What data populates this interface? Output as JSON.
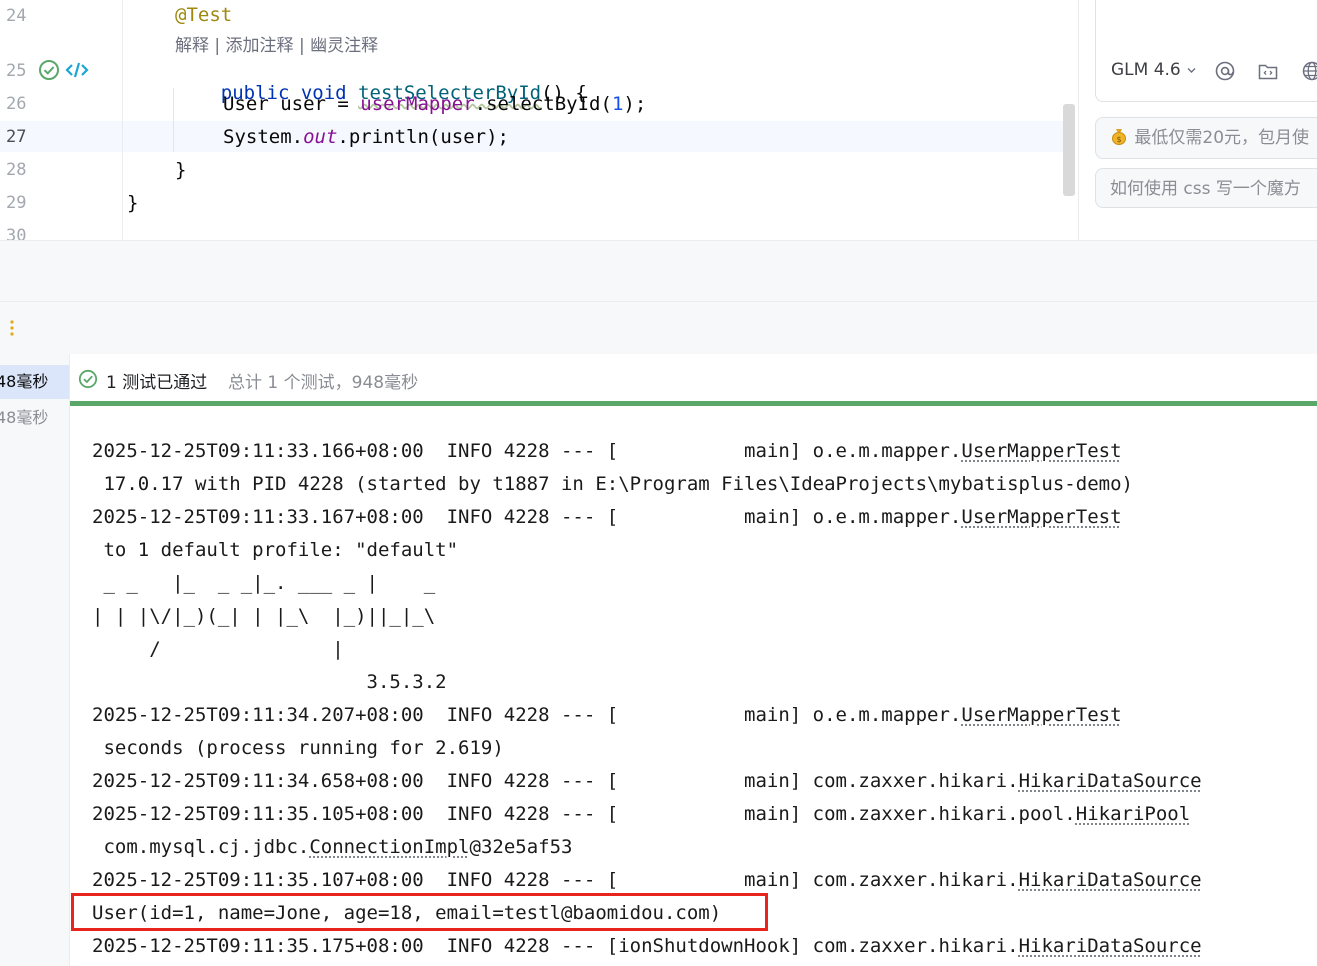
{
  "editor": {
    "line_numbers": [
      "24",
      "25",
      "26",
      "27",
      "28",
      "29",
      "30"
    ],
    "annotation": "@Test",
    "inline_hint": "解释 | 添加注释 | 幽灵注释",
    "method_kw1": "public",
    "method_kw2": "void",
    "method_name": "testSelecterById",
    "method_tail": "() {",
    "line26_type": "User user = ",
    "line26_field": "userMapper",
    "line26_call": ".selectById(",
    "line26_arg": "1",
    "line26_end": ");",
    "line27_a": "System.",
    "line27_static": "out",
    "line27_b": ".println(user);",
    "line28": "}",
    "line29": "}"
  },
  "ai_panel": {
    "model_label": "GLM 4.6",
    "suggestion_1": "最低仅需20元，包月使",
    "suggestion_2": "如何使用 css 写一个魔方",
    "icons": [
      "coin-icon",
      "at-icon",
      "folder-code-icon",
      "globe-icon",
      "chevron-down-icon"
    ]
  },
  "test_tree": {
    "items": [
      "48毫秒",
      "48毫秒"
    ]
  },
  "test_status": {
    "main": "1 测试已通过",
    "sub": "总计 1 个测试，948毫秒"
  },
  "console": {
    "lines": [
      {
        "prefix": "2025-12-25T09:11:33.166+08:00  INFO 4228 --- [           main] o.e.m.mapper.",
        "link": "UserMapperTest"
      },
      {
        "prefix": " 17.0.17 with PID 4228 (started by t1887 in E:\\Program Files\\IdeaProjects\\mybatisplus-demo)",
        "link": ""
      },
      {
        "prefix": "2025-12-25T09:11:33.167+08:00  INFO 4228 --- [           main] o.e.m.mapper.",
        "link": "UserMapperTest"
      },
      {
        "prefix": " to 1 default profile: \"default\"",
        "link": ""
      },
      {
        "prefix": " _ _   |_  _ _|_. ___ _ |    _",
        "link": ""
      },
      {
        "prefix": "| | |\\/|_)(_| | |_\\  |_)||_|_\\",
        "link": ""
      },
      {
        "prefix": "     /               |",
        "link": ""
      },
      {
        "prefix": "                        3.5.3.2",
        "link": ""
      },
      {
        "prefix": "2025-12-25T09:11:34.207+08:00  INFO 4228 --- [           main] o.e.m.mapper.",
        "link": "UserMapperTest"
      },
      {
        "prefix": " seconds (process running for 2.619)",
        "link": ""
      },
      {
        "prefix": "2025-12-25T09:11:34.658+08:00  INFO 4228 --- [           main] com.zaxxer.hikari.",
        "link": "HikariDataSource"
      },
      {
        "prefix": "2025-12-25T09:11:35.105+08:00  INFO 4228 --- [           main] com.zaxxer.hikari.pool.",
        "link": "HikariPool"
      },
      {
        "prefix": " com.mysql.cj.jdbc.",
        "link": "ConnectionImpl",
        "suffix": "@32e5af53"
      },
      {
        "prefix": "2025-12-25T09:11:35.107+08:00  INFO 4228 --- [           main] com.zaxxer.hikari.",
        "link": "HikariDataSource"
      },
      {
        "prefix": "User(id=1, name=Jone, age=18, email=testl@baomidou.com)",
        "link": ""
      },
      {
        "prefix": "2025-12-25T09:11:35.175+08:00  INFO 4228 --- [ionShutdownHook] com.zaxxer.hikari.",
        "link": "HikariDataSource"
      }
    ]
  },
  "colors": {
    "accent_pass": "#59a869",
    "highlight_box": "#e8251d"
  }
}
